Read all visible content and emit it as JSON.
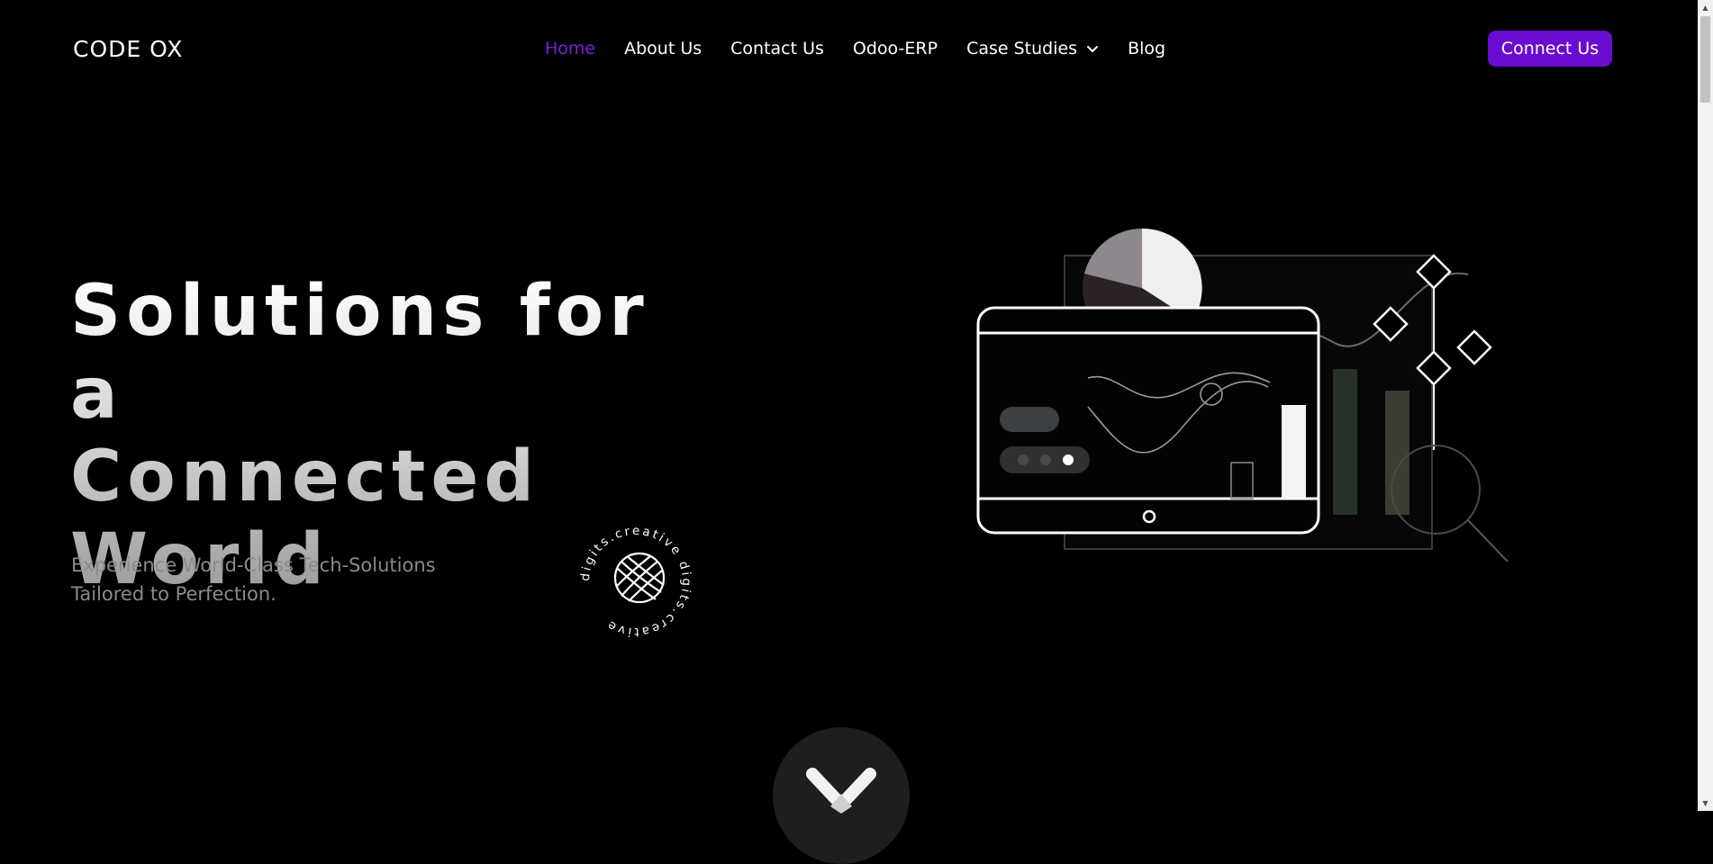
{
  "brand": {
    "logo_text": "CODE OX"
  },
  "nav": {
    "items": [
      {
        "label": "Home",
        "active": true
      },
      {
        "label": "About Us"
      },
      {
        "label": "Contact Us"
      },
      {
        "label": "Odoo-ERP"
      },
      {
        "label": "Case Studies",
        "has_dropdown": true
      },
      {
        "label": "Blog"
      }
    ],
    "cta_label": "Connect Us"
  },
  "hero": {
    "title_lines": [
      "Solutions for a",
      "Connected",
      "World"
    ],
    "subtitle_lines": [
      "Experience World-Class Tech-Solutions",
      "Tailored to Perfection."
    ],
    "badge_text": "digits.creative digits.creative "
  },
  "colors": {
    "accent": "#6a0ccf",
    "active_link": "#7a1fd6",
    "background": "#000000",
    "subtitle": "#8a8a8a"
  },
  "icons": {
    "dropdown": "chevron-down-icon",
    "badge_center": "globe-icon",
    "scroll": "chevron-down-icon"
  }
}
